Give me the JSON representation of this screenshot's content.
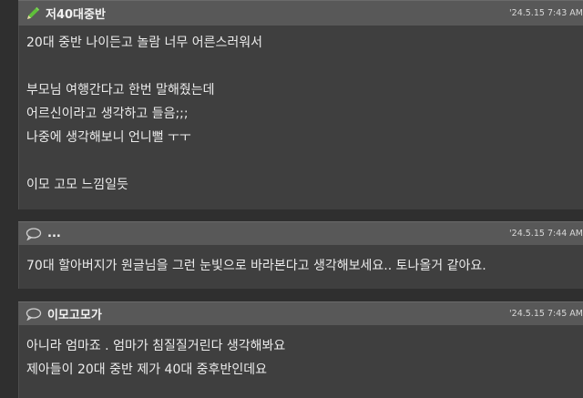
{
  "posts": [
    {
      "author": "저40대중반",
      "date": "'24.5.15 7:43 AM",
      "icon": "pencil-icon",
      "lines": [
        "20대 중반 나이든고 놀람 너무 어른스러워서",
        "",
        "부모님 여행간다고 한번 말해줬는데",
        "어르신이라고 생각하고 들음;;;",
        "나중에 생각해보니 언니뻘 ㅜㅜ",
        "",
        "이모 고모 느낌일듯"
      ]
    },
    {
      "author": "...",
      "date": "'24.5.15 7:44 AM",
      "icon": "comment-bubble-icon",
      "lines": [
        "70대 할아버지가 원글님을 그런 눈빛으로 바라본다고 생각해보세요.. 토나올거 같아요."
      ]
    },
    {
      "author": "이모고모가",
      "date": "'24.5.15 7:45 AM",
      "icon": "comment-bubble-icon",
      "lines": [
        "아니라 엄마죠 . 엄마가 침질질거린다 생각해봐요",
        "제아들이 20대 중반 제가 40대 중후반인데요"
      ]
    }
  ]
}
